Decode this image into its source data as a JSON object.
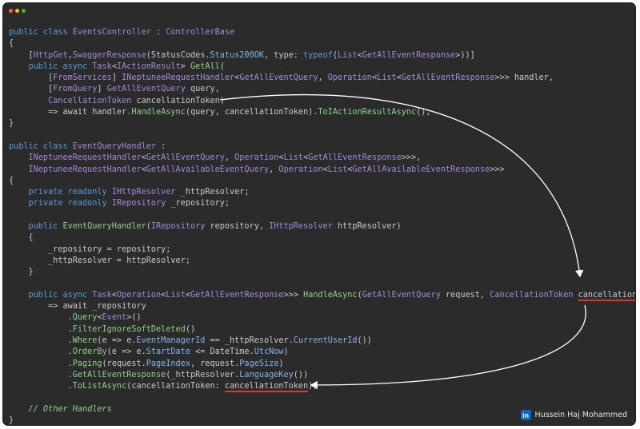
{
  "window": {
    "controls": [
      {
        "name": "close",
        "color": "#ff5f57"
      },
      {
        "name": "minimize",
        "color": "#febc2e"
      },
      {
        "name": "maximize",
        "color": "#28c840"
      }
    ]
  },
  "code_lines": [
    [
      [
        "kw",
        "public class "
      ],
      [
        "ty",
        "EventsController"
      ],
      [
        "pl",
        " : "
      ],
      [
        "ty",
        "ControllerBase"
      ]
    ],
    [
      [
        "pl",
        "{"
      ]
    ],
    [
      [
        "pl",
        "    ["
      ],
      [
        "ty",
        "HttpGet"
      ],
      [
        "pl",
        ","
      ],
      [
        "ty",
        "SwaggerResponse"
      ],
      [
        "pl",
        "(StatusCodes."
      ],
      [
        "pr",
        "Status200OK"
      ],
      [
        "pl",
        ", type: "
      ],
      [
        "kw",
        "typeof"
      ],
      [
        "pl",
        "("
      ],
      [
        "ty",
        "List"
      ],
      [
        "pl",
        "<"
      ],
      [
        "ty",
        "GetAllEventResponse"
      ],
      [
        "pl",
        ">))]"
      ]
    ],
    [
      [
        "kw",
        "    public async "
      ],
      [
        "ty",
        "Task"
      ],
      [
        "pl",
        "<"
      ],
      [
        "ty",
        "IActionResult"
      ],
      [
        "pl",
        "> "
      ],
      [
        "fn",
        "GetAll"
      ],
      [
        "pl",
        "("
      ]
    ],
    [
      [
        "pl",
        "        ["
      ],
      [
        "ty",
        "FromServices"
      ],
      [
        "pl",
        "] "
      ],
      [
        "ty",
        "INeptuneeRequestHandler"
      ],
      [
        "pl",
        "<"
      ],
      [
        "ty",
        "GetAllEventQuery"
      ],
      [
        "pl",
        ", "
      ],
      [
        "ty",
        "Operation"
      ],
      [
        "pl",
        "<"
      ],
      [
        "ty",
        "List"
      ],
      [
        "pl",
        "<"
      ],
      [
        "ty",
        "GetAllEventResponse"
      ],
      [
        "pl",
        ">>> handler,"
      ]
    ],
    [
      [
        "pl",
        "        ["
      ],
      [
        "ty",
        "FromQuery"
      ],
      [
        "pl",
        "] "
      ],
      [
        "ty",
        "GetAllEventQuery"
      ],
      [
        "pl",
        " query,"
      ]
    ],
    [
      [
        "ty",
        "        CancellationToken"
      ],
      [
        "pl",
        " cancellationToken)"
      ]
    ],
    [
      [
        "pl",
        "        => await handler."
      ],
      [
        "fn",
        "HandleAsync"
      ],
      [
        "pl",
        "(query, cancellationToken)."
      ],
      [
        "fn",
        "ToIActionResultAsync"
      ],
      [
        "pl",
        "();"
      ]
    ],
    [
      [
        "pl",
        "}"
      ]
    ],
    [
      [
        "pl",
        ""
      ]
    ],
    [
      [
        "kw",
        "public class "
      ],
      [
        "ty",
        "EventQueryHandler"
      ],
      [
        "pl",
        " :"
      ]
    ],
    [
      [
        "ty",
        "    INeptuneeRequestHandler"
      ],
      [
        "pl",
        "<"
      ],
      [
        "ty",
        "GetAllEventQuery"
      ],
      [
        "pl",
        ", "
      ],
      [
        "ty",
        "Operation"
      ],
      [
        "pl",
        "<"
      ],
      [
        "ty",
        "List"
      ],
      [
        "pl",
        "<"
      ],
      [
        "ty",
        "GetAllEventResponse"
      ],
      [
        "pl",
        ">>>,"
      ]
    ],
    [
      [
        "ty",
        "    INeptuneeRequestHandler"
      ],
      [
        "pl",
        "<"
      ],
      [
        "ty",
        "GetAllAvailableEventQuery"
      ],
      [
        "pl",
        ", "
      ],
      [
        "ty",
        "Operation"
      ],
      [
        "pl",
        "<"
      ],
      [
        "ty",
        "List"
      ],
      [
        "pl",
        "<"
      ],
      [
        "ty",
        "GetAllAvailableEventResponse"
      ],
      [
        "pl",
        ">>>"
      ]
    ],
    [
      [
        "pl",
        "{"
      ]
    ],
    [
      [
        "kw",
        "    private readonly "
      ],
      [
        "ty",
        "IHttpResolver"
      ],
      [
        "pl",
        " _httpResolver;"
      ]
    ],
    [
      [
        "kw",
        "    private readonly "
      ],
      [
        "ty",
        "IRepository"
      ],
      [
        "pl",
        " _repository;"
      ]
    ],
    [
      [
        "pl",
        ""
      ]
    ],
    [
      [
        "kw",
        "    public "
      ],
      [
        "fn",
        "EventQueryHandler"
      ],
      [
        "pl",
        "("
      ],
      [
        "ty",
        "IRepository"
      ],
      [
        "pl",
        " repository, "
      ],
      [
        "ty",
        "IHttpResolver"
      ],
      [
        "pl",
        " httpResolver)"
      ]
    ],
    [
      [
        "pl",
        "    {"
      ]
    ],
    [
      [
        "pl",
        "        _repository = repository;"
      ]
    ],
    [
      [
        "pl",
        "        _httpResolver = httpResolver;"
      ]
    ],
    [
      [
        "pl",
        "    }"
      ]
    ],
    [
      [
        "pl",
        ""
      ]
    ],
    [
      [
        "kw",
        "    public async "
      ],
      [
        "ty",
        "Task"
      ],
      [
        "pl",
        "<"
      ],
      [
        "ty",
        "Operation"
      ],
      [
        "pl",
        "<"
      ],
      [
        "ty",
        "List"
      ],
      [
        "pl",
        "<"
      ],
      [
        "ty",
        "GetAllEventResponse"
      ],
      [
        "pl",
        ">>> "
      ],
      [
        "fn",
        "HandleAsync"
      ],
      [
        "pl",
        "("
      ],
      [
        "ty",
        "GetAllEventQuery"
      ],
      [
        "pl",
        " request, "
      ],
      [
        "ty",
        "CancellationToken"
      ],
      [
        "pl",
        " "
      ],
      [
        "ul",
        "cancellationToken"
      ],
      [
        "pl",
        ")"
      ]
    ],
    [
      [
        "pl",
        "        => await _repository"
      ]
    ],
    [
      [
        "pl",
        "            ."
      ],
      [
        "fn",
        "Query"
      ],
      [
        "pl",
        "<"
      ],
      [
        "ty",
        "Event"
      ],
      [
        "pl",
        ">()"
      ]
    ],
    [
      [
        "pl",
        "            ."
      ],
      [
        "fn",
        "FilterIgnoreSoftDeleted"
      ],
      [
        "pl",
        "()"
      ]
    ],
    [
      [
        "pl",
        "            ."
      ],
      [
        "fn",
        "Where"
      ],
      [
        "pl",
        "(e => e."
      ],
      [
        "pr",
        "EventManagerId"
      ],
      [
        "pl",
        " == _httpResolver."
      ],
      [
        "pr",
        "CurrentUserId"
      ],
      [
        "pl",
        "())"
      ]
    ],
    [
      [
        "pl",
        "            ."
      ],
      [
        "fn",
        "OrderBy"
      ],
      [
        "pl",
        "(e => e."
      ],
      [
        "pr",
        "StartDate"
      ],
      [
        "pl",
        " <= DateTime."
      ],
      [
        "pr",
        "UtcNow"
      ],
      [
        "pl",
        ")"
      ]
    ],
    [
      [
        "pl",
        "            ."
      ],
      [
        "fn",
        "Paging"
      ],
      [
        "pl",
        "(request."
      ],
      [
        "pr",
        "PageIndex"
      ],
      [
        "pl",
        ", request."
      ],
      [
        "pr",
        "PageSize"
      ],
      [
        "pl",
        ")"
      ]
    ],
    [
      [
        "pl",
        "            ."
      ],
      [
        "fn",
        "GetAllEventResponse"
      ],
      [
        "pl",
        "(_httpResolver."
      ],
      [
        "pr",
        "LanguageKey"
      ],
      [
        "pl",
        "())"
      ]
    ],
    [
      [
        "pl",
        "            ."
      ],
      [
        "fn",
        "ToListAsync"
      ],
      [
        "pl",
        "(cancellationToken: "
      ],
      [
        "ul",
        "cancellationToken"
      ],
      [
        "pl",
        ");"
      ]
    ],
    [
      [
        "pl",
        ""
      ]
    ],
    [
      [
        "cm",
        "    // Other Handlers"
      ]
    ],
    [
      [
        "pl",
        "}"
      ]
    ]
  ],
  "credit": {
    "icon": "linkedin-icon",
    "icon_text": "in",
    "author": "Hussein Haj Mohammed"
  },
  "colors": {
    "background": "#2b2b2b",
    "keyword": "#5b9bd5",
    "type": "#a58ad8",
    "method": "#8fd18a",
    "property": "#82b4e6",
    "underline": "#e0352b",
    "arrow": "#ffffff"
  }
}
